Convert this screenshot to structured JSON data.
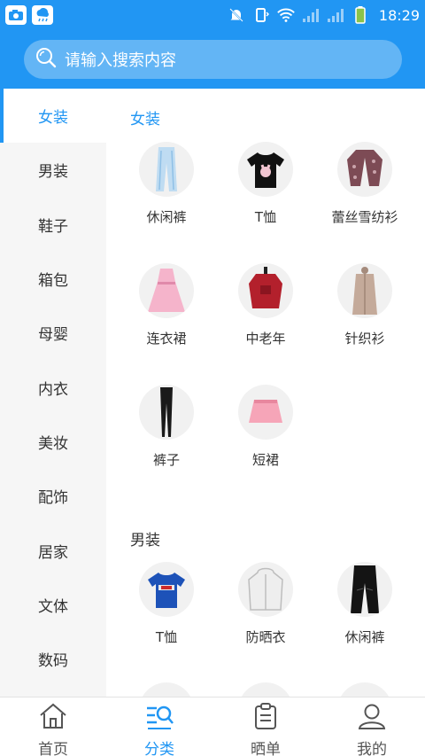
{
  "status_bar": {
    "time": "18:29",
    "left_icons": [
      "camera-icon",
      "cloud-rain-icon"
    ],
    "right_icons": [
      "bell-off-icon",
      "vibrate-icon",
      "wifi-icon",
      "signal-icon",
      "signal-icon",
      "battery-icon"
    ]
  },
  "search": {
    "placeholder": "请输入搜索内容",
    "icon": "search-icon"
  },
  "sidebar": {
    "active_index": 0,
    "items": [
      {
        "label": "女装"
      },
      {
        "label": "男装"
      },
      {
        "label": "鞋子"
      },
      {
        "label": "箱包"
      },
      {
        "label": "母婴"
      },
      {
        "label": "内衣"
      },
      {
        "label": "美妆"
      },
      {
        "label": "配饰"
      },
      {
        "label": "居家"
      },
      {
        "label": "文体"
      },
      {
        "label": "数码"
      }
    ]
  },
  "sections": [
    {
      "title": "女装",
      "items": [
        {
          "label": "休闲裤",
          "icon": "casual-pants-icon"
        },
        {
          "label": "T恤",
          "icon": "tshirt-icon"
        },
        {
          "label": "蕾丝雪纺衫",
          "icon": "chiffon-shirt-icon"
        },
        {
          "label": "连衣裙",
          "icon": "dress-icon"
        },
        {
          "label": "中老年",
          "icon": "sweater-icon"
        },
        {
          "label": "针织衫",
          "icon": "cardigan-icon"
        },
        {
          "label": "裤子",
          "icon": "leggings-icon"
        },
        {
          "label": "短裙",
          "icon": "skirt-icon"
        }
      ]
    },
    {
      "title": "男装",
      "items": [
        {
          "label": "T恤",
          "icon": "tshirt-icon"
        },
        {
          "label": "防晒衣",
          "icon": "sun-jacket-icon"
        },
        {
          "label": "休闲裤",
          "icon": "casual-pants-icon"
        }
      ]
    }
  ],
  "tabbar": {
    "active_index": 1,
    "tabs": [
      {
        "label": "首页",
        "icon": "home-icon"
      },
      {
        "label": "分类",
        "icon": "category-icon"
      },
      {
        "label": "晒单",
        "icon": "clipboard-icon"
      },
      {
        "label": "我的",
        "icon": "user-icon"
      }
    ]
  },
  "colors": {
    "primary": "#2196f3",
    "search_bg": "#63b5f5",
    "sidebar_bg": "#f6f6f6",
    "thumb_bg": "#f1f1f1"
  }
}
